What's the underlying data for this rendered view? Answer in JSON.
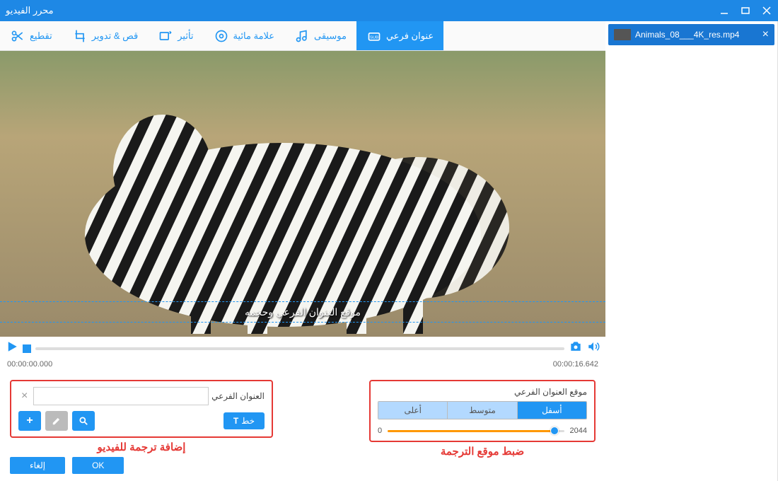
{
  "window": {
    "title": "محرر الفيديو"
  },
  "file": {
    "name": "Animals_08___4K_res.mp4"
  },
  "toolbar": [
    {
      "id": "cut",
      "label": "تقطيع"
    },
    {
      "id": "crop",
      "label": "قص & تدوير"
    },
    {
      "id": "effect",
      "label": "تأثير"
    },
    {
      "id": "watermark",
      "label": "علامة مائية"
    },
    {
      "id": "music",
      "label": "موسيقى"
    },
    {
      "id": "subtitle",
      "label": "عنوان فرعي",
      "active": true
    }
  ],
  "preview": {
    "subtitle_sample": "موقع العنوان الفرعي وحجمه"
  },
  "player": {
    "current": "00:00:00.000",
    "duration": "00:00:16.642"
  },
  "subtitle_panel": {
    "label": "العنوان الفرعي",
    "input_value": "",
    "font_button": "خط",
    "caption": "إضافة ترجمة للفيديو"
  },
  "position_panel": {
    "label": "موقع العنوان الفرعي",
    "options": {
      "bottom": "أسفل",
      "middle": "متوسط",
      "top": "أعلى"
    },
    "active": "bottom",
    "slider": {
      "min": "0",
      "max": "2044",
      "value": 1940
    },
    "caption": "ضبط موقع الترجمة"
  },
  "footer": {
    "ok": "OK",
    "cancel": "إلغاء"
  }
}
